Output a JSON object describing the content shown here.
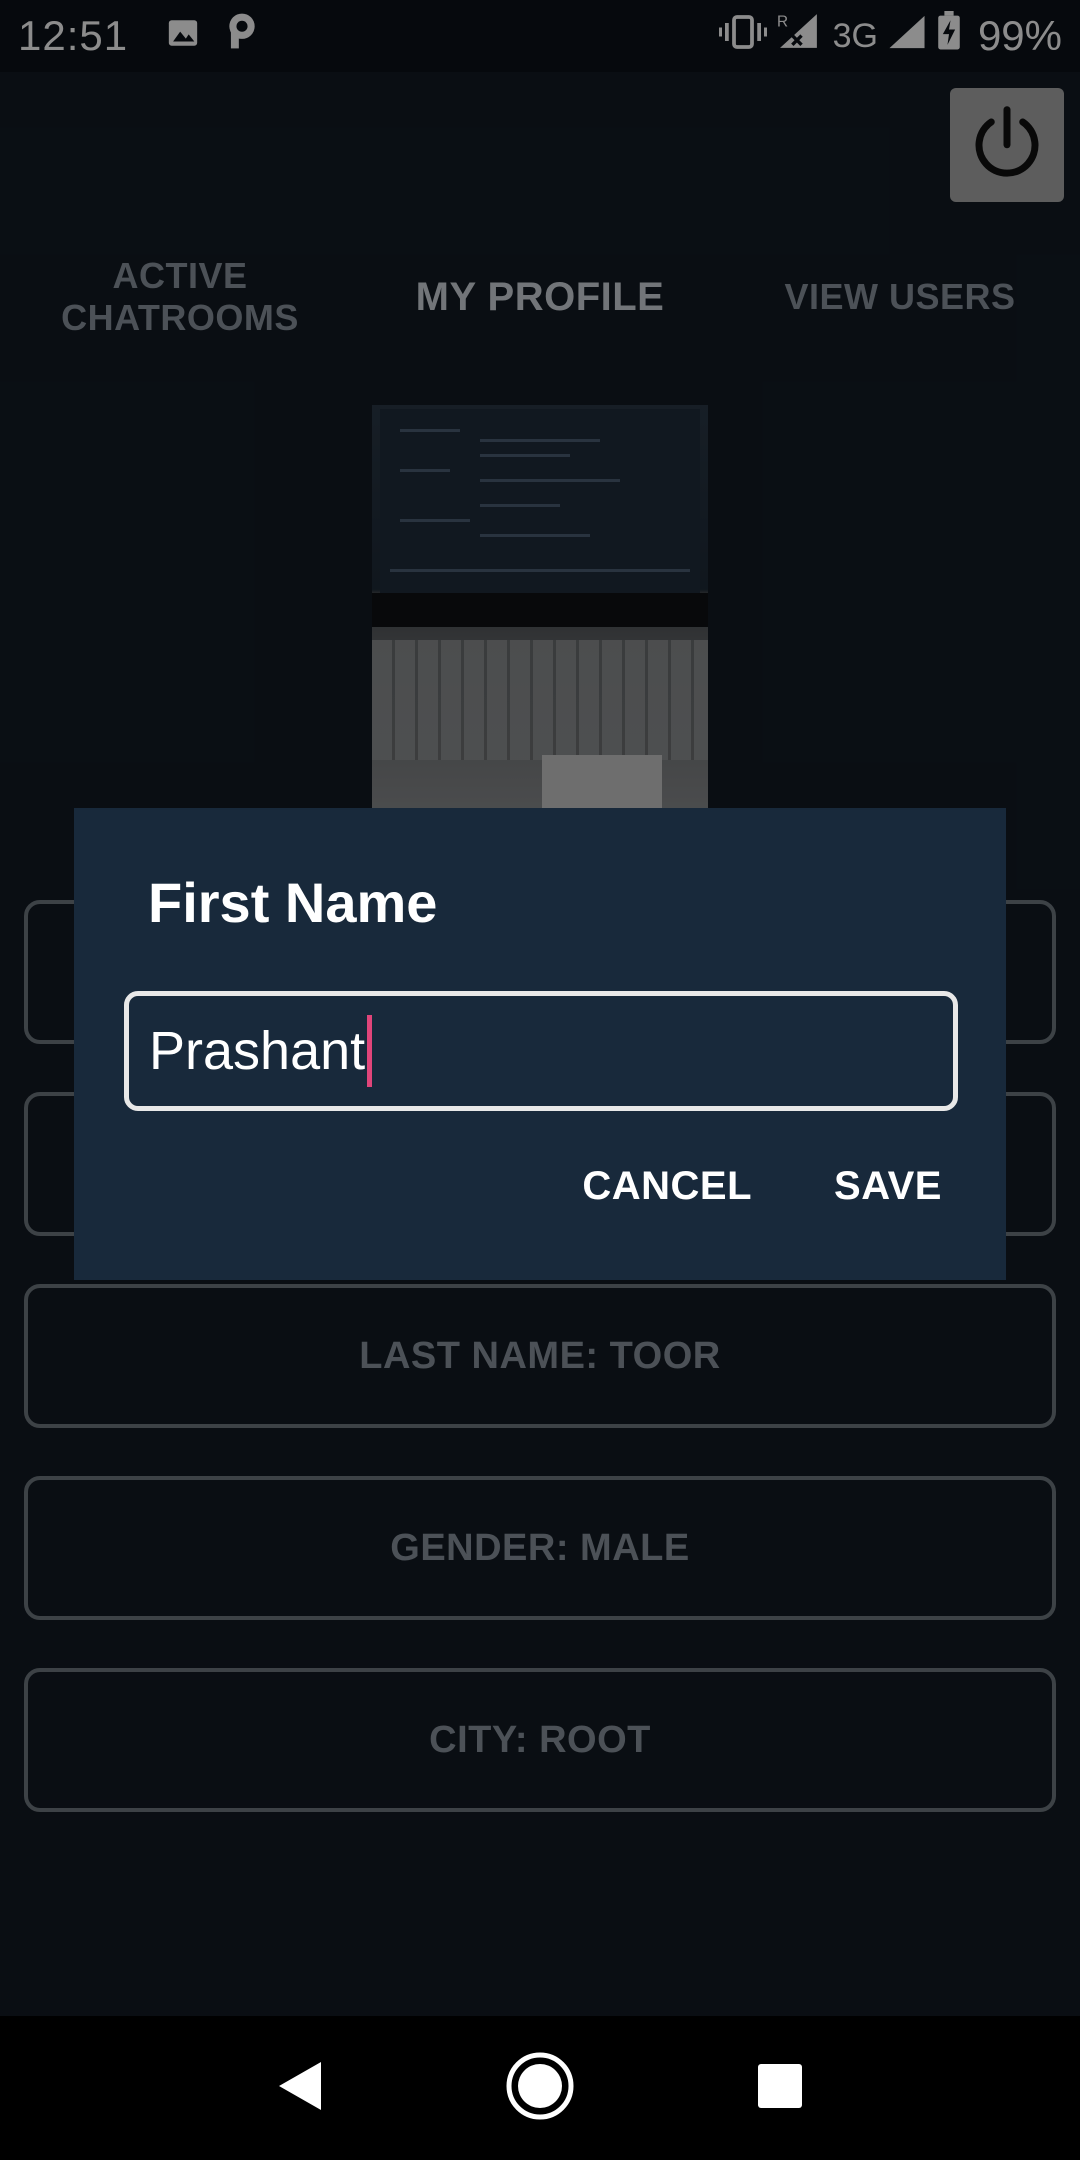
{
  "status_bar": {
    "time": "12:51",
    "network": "3G",
    "roaming": "R",
    "battery": "99%",
    "icons": [
      "image-notification-icon",
      "parking-notification-icon",
      "vibrate-icon",
      "signal-roaming-icon",
      "signal-icon",
      "battery-charging-icon"
    ]
  },
  "tabs": [
    {
      "line1": "ACTIVE",
      "line2": "CHATROOMS",
      "active": false
    },
    {
      "line1": "MY PROFILE",
      "line2": "",
      "active": true
    },
    {
      "line1": "VIEW USERS",
      "line2": "",
      "active": false
    }
  ],
  "profile_fields": {
    "last_name": "LAST NAME: TOOR",
    "gender": "GENDER: MALE",
    "city": "CITY: ROOT"
  },
  "dialog": {
    "title": "First Name",
    "input_value": "Prashant",
    "cancel_label": "CANCEL",
    "save_label": "SAVE"
  },
  "colors": {
    "background": "#131b24",
    "dialog": "#18293b",
    "caret": "#e0457a",
    "power_button": "#a9a9a9"
  }
}
